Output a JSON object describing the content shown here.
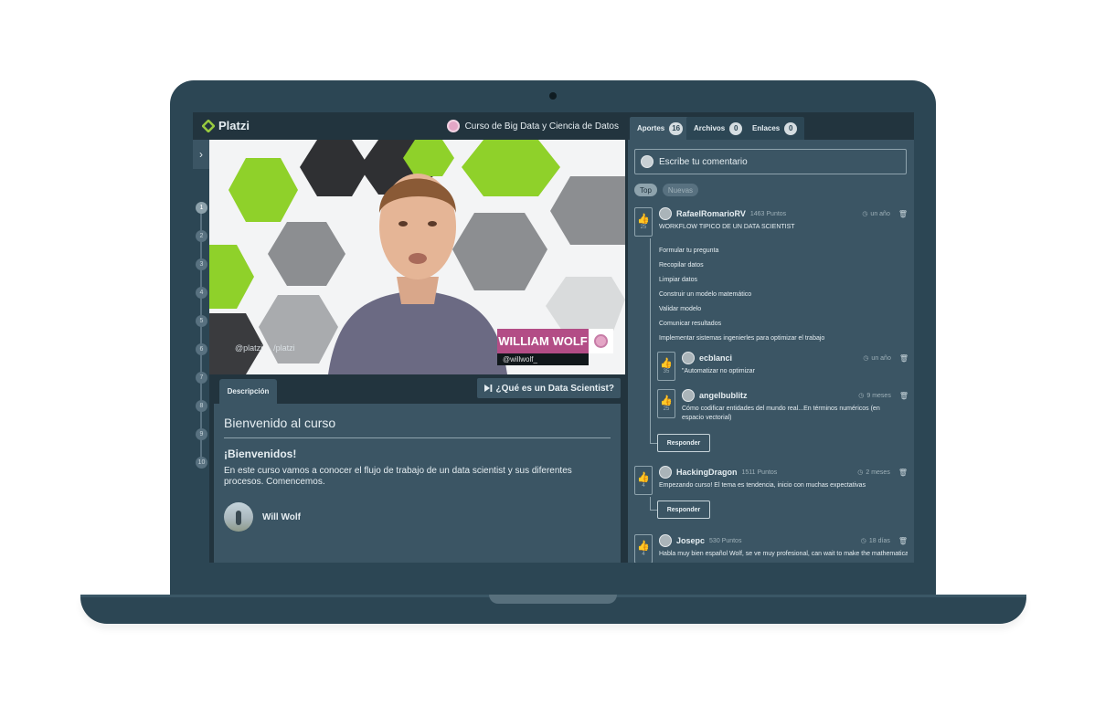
{
  "app": {
    "logo": "Platzi",
    "course": "Curso de Big Data y Ciencia de Datos"
  },
  "rail": {
    "toggle": "›",
    "lessons": [
      "1",
      "2",
      "3",
      "4",
      "5",
      "6",
      "7",
      "8",
      "9",
      "10"
    ],
    "active": 0
  },
  "video": {
    "name_tag": "WILLIAM WOLF",
    "name_handle": "@willwolf_",
    "watermark_twitter": "@platzi",
    "watermark_facebook": "/platzi"
  },
  "description": {
    "tab": "Descripción",
    "next_lesson": "¿Qué es un Data Scientist?",
    "title": "Bienvenido al curso",
    "subtitle": "¡Bienvenidos!",
    "body": "En este curso vamos a conocer el flujo de trabajo de un data scientist y sus diferentes procesos. Comencemos.",
    "author": "Will Wolf"
  },
  "tabs": [
    {
      "label": "Aportes",
      "count": "16"
    },
    {
      "label": "Archivos",
      "count": "0"
    },
    {
      "label": "Enlaces",
      "count": "0"
    }
  ],
  "comment_placeholder": "Escribe tu comentario",
  "filters": [
    "Top",
    "Nuevas"
  ],
  "comments": [
    {
      "user": "RafaelRomarioRV",
      "points": "1463 Puntos",
      "time": "un año",
      "votes": "25",
      "text": "WORKFLOW TIPICO DE UN DATA SCIENTIST",
      "items": [
        "Formular tu pregunta",
        "Recopilar datos",
        "Limpiar datos",
        "Construir un modelo matemático",
        "Validar modelo",
        "Comunicar resultados",
        "Implementar sistemas ingenierles para optimizar el trabajo"
      ]
    },
    {
      "user": "ecblanci",
      "time": "un año",
      "votes": "35",
      "text": "\"Automatizar no optimizar"
    },
    {
      "user": "angelbublitz",
      "time": "9 meses",
      "votes": "25",
      "text": "Cómo codificar entidades del mundo real...En términos numéricos (en espacio vectorial)"
    },
    {
      "user": "HackingDragon",
      "points": "1511 Puntos",
      "time": "2 meses",
      "votes": "4",
      "text": "Empezando curso! El tema es tendencia, inicio con muchas expectativas"
    },
    {
      "user": "Josepc",
      "points": "530 Puntos",
      "time": "18 días",
      "votes": "4",
      "text": "Habla muy bien español Wolf, se ve muy profesional, can wait to make the mathematical"
    }
  ],
  "reply_label": "Responder"
}
